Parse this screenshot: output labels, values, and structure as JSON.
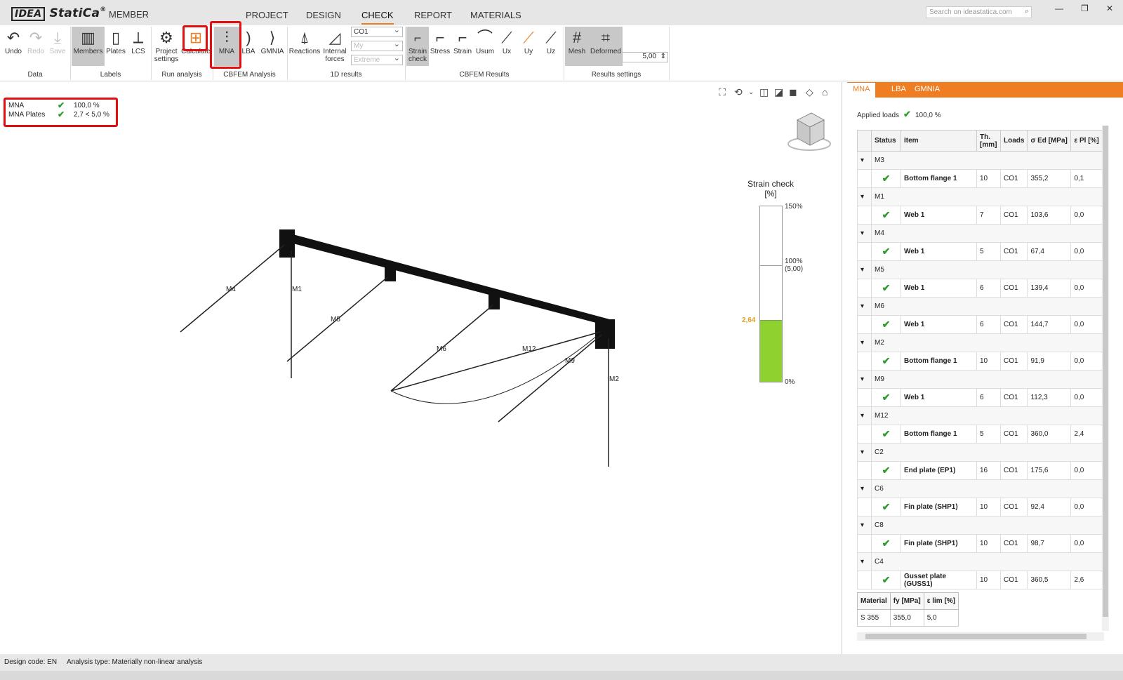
{
  "app": {
    "logo": "IDEA",
    "brand": "StatiCa",
    "reg": "®",
    "module": "MEMBER"
  },
  "menu": [
    "PROJECT",
    "DESIGN",
    "CHECK",
    "REPORT",
    "MATERIALS"
  ],
  "active_menu": "CHECK",
  "search": {
    "placeholder": "Search on ideastatica.com"
  },
  "ribbon": {
    "data": {
      "label": "Data",
      "undo": "Undo",
      "redo": "Redo",
      "save": "Save"
    },
    "labels": {
      "label": "Labels",
      "members": "Members",
      "plates": "Plates",
      "lcs": "LCS"
    },
    "run": {
      "label": "Run analysis",
      "project_settings": "Project settings",
      "calculate": "Calculate"
    },
    "cbfem_analysis": {
      "label": "CBFEM Analysis",
      "mna": "MNA",
      "lba": "LBA",
      "gmnia": "GMNIA"
    },
    "results_1d": {
      "label": "1D results",
      "reactions": "Reactions",
      "internal_forces": "Internal forces",
      "dd_case": "CO1",
      "dd_comp": "My",
      "dd_ext": "Extreme"
    },
    "cbfem_results": {
      "label": "CBFEM Results",
      "strain_check": "Strain check",
      "stress": "Stress",
      "strain": "Strain",
      "usum": "Usum",
      "ux": "Ux",
      "uy": "Uy",
      "uz": "Uz"
    },
    "results_settings": {
      "label": "Results settings",
      "mesh": "Mesh",
      "deformed": "Deformed",
      "scale": "5,00"
    }
  },
  "summary": [
    {
      "name": "MNA",
      "value": "100,0 %"
    },
    {
      "name": "MNA Plates",
      "value": "2,7 < 5,0 %"
    }
  ],
  "legend": {
    "title": "Strain check",
    "unit": "[%]",
    "max": "150%",
    "limit": "100%",
    "limit_sub": "(5,00)",
    "current": "2,64",
    "min": "0%",
    "fill_fraction": 0.352
  },
  "model_labels": [
    "M4",
    "M1",
    "M5",
    "M6",
    "M12",
    "M9",
    "M2"
  ],
  "side": {
    "tabs": [
      "MNA",
      "LBA",
      "GMNIA"
    ],
    "applied_label": "Applied loads",
    "applied_value": "100,0 %",
    "columns": [
      "Status",
      "Item",
      "Th. [mm]",
      "Loads",
      "σ Ed [MPa]",
      "ε Pl [%]"
    ],
    "groups": [
      {
        "name": "M3",
        "item": "Bottom flange 1",
        "th": "10",
        "loads": "CO1",
        "sigma": "355,2",
        "eps": "0,1"
      },
      {
        "name": "M1",
        "item": "Web 1",
        "th": "7",
        "loads": "CO1",
        "sigma": "103,6",
        "eps": "0,0"
      },
      {
        "name": "M4",
        "item": "Web 1",
        "th": "5",
        "loads": "CO1",
        "sigma": "67,4",
        "eps": "0,0"
      },
      {
        "name": "M5",
        "item": "Web 1",
        "th": "6",
        "loads": "CO1",
        "sigma": "139,4",
        "eps": "0,0"
      },
      {
        "name": "M6",
        "item": "Web 1",
        "th": "6",
        "loads": "CO1",
        "sigma": "144,7",
        "eps": "0,0"
      },
      {
        "name": "M2",
        "item": "Bottom flange 1",
        "th": "10",
        "loads": "CO1",
        "sigma": "91,9",
        "eps": "0,0"
      },
      {
        "name": "M9",
        "item": "Web 1",
        "th": "6",
        "loads": "CO1",
        "sigma": "112,3",
        "eps": "0,0"
      },
      {
        "name": "M12",
        "item": "Bottom flange 1",
        "th": "5",
        "loads": "CO1",
        "sigma": "360,0",
        "eps": "2,4"
      },
      {
        "name": "C2",
        "item": "End plate (EP1)",
        "th": "16",
        "loads": "CO1",
        "sigma": "175,6",
        "eps": "0,0"
      },
      {
        "name": "C6",
        "item": "Fin plate (SHP1)",
        "th": "10",
        "loads": "CO1",
        "sigma": "92,4",
        "eps": "0,0"
      },
      {
        "name": "C8",
        "item": "Fin plate (SHP1)",
        "th": "10",
        "loads": "CO1",
        "sigma": "98,7",
        "eps": "0,0"
      },
      {
        "name": "C4",
        "item": "Gusset plate (GUSS1)",
        "th": "10",
        "loads": "CO1",
        "sigma": "360,5",
        "eps": "2,6"
      }
    ],
    "material": {
      "headers": [
        "Material",
        "fy [MPa]",
        "ε lim [%]"
      ],
      "row": [
        "S 355",
        "355,0",
        "5,0"
      ]
    }
  },
  "status": {
    "design_code_label": "Design code:",
    "design_code": "EN",
    "analysis_label": "Analysis type:",
    "analysis": "Materially non-linear analysis"
  },
  "colors": {
    "accent": "#ef7d22",
    "ok": "#2a9d2a",
    "highlight": "#e01010",
    "fill": "#8fd12e"
  }
}
